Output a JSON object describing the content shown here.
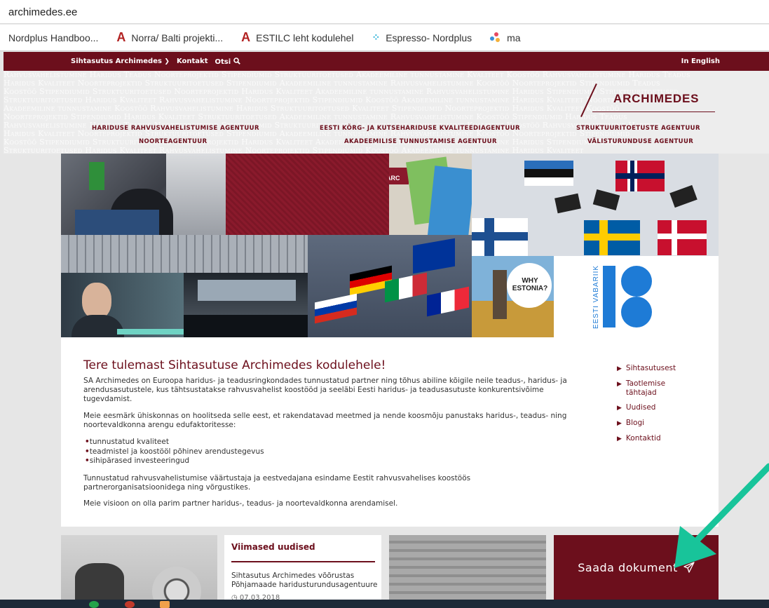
{
  "browser": {
    "url": "archimedes.ee",
    "bookmarks": [
      {
        "label": "Nordplus Handboo...",
        "icon": "none"
      },
      {
        "label": "Norra/ Balti projekti...",
        "icon": "archimedes-a-icon"
      },
      {
        "label": "ESTILC leht kodulehel",
        "icon": "archimedes-a-icon"
      },
      {
        "label": "Espresso- Nordplus",
        "icon": "dots-icon"
      },
      {
        "label": "ma",
        "icon": "color-dots-icon"
      }
    ]
  },
  "nav": {
    "items": [
      "Sihtasutus Archimedes",
      "Kontakt",
      "Otsi"
    ],
    "english": "In English"
  },
  "header": {
    "logo": "ARCHIMEDES",
    "agencies": [
      "HARIDUSE RAHVUSVAHELISTUMISE AGENTUUR",
      "NOORTEAGENTUUR",
      "EESTI KÕRG- JA KUTSEHARIDUSE KVALITEEDIAGENTUUR",
      "AKADEEMILISE TUNNUSTAMISE AGENTUUR",
      "STRUKTUURITOETUSTE AGENTUUR",
      "VÄLISTURUNDUSE AGENTUUR"
    ]
  },
  "collage": {
    "mini_logo": "ARC",
    "why_estonia": "WHY ESTONIA?",
    "eesti_vabariik": "EESTI VABARIIK",
    "eighteen": "18"
  },
  "main": {
    "title": "Tere tulemast Sihtasutuse Archimedes kodulehele!",
    "p1": "SA Archimedes on Euroopa haridus- ja teadusringkondades tunnustatud partner ning tõhus abiline kõigile neile teadus-, haridus- ja arendusasutustele, kus tähtsustatakse rahvusvahelist koostööd ja seeläbi Eesti haridus- ja teadusasutuste konkurentsivõime tugevdamist.",
    "p2": "Meie eesmärk ühiskonnas on hoolitseda selle eest, et rakendatavad meetmed ja nende koosmõju panustaks haridus-, teadus- ning noortevaldkonna arengu edufaktoritesse:",
    "bullets": [
      "tunnustatud kvaliteet",
      "teadmistel ja koostööl põhinev arendustegevus",
      "sihipärased investeeringud"
    ],
    "p3": "Tunnustatud rahvusvahelistumise väärtustaja ja eestvedajana esindame Eestit rahvusvahelises koostöös partnerorganisatsioonidega ning võrgustikes.",
    "p4": "Meie visioon on olla parim partner haridus-, teadus- ja noortevaldkonna arendamisel.",
    "side_links": [
      "Sihtasutusest",
      "Taotlemise tähtajad",
      "Uudised",
      "Blogi",
      "Kontaktid"
    ]
  },
  "news": {
    "title": "Viimased uudised",
    "item": "Sihtasutus Archimedes võõrustas Põhjamaade haridusturundusagentuure",
    "date": "07.03.2018"
  },
  "send": {
    "label": "Saada dokument"
  },
  "colors": {
    "brand": "#6c0f1c",
    "arrow": "#18c49a"
  }
}
